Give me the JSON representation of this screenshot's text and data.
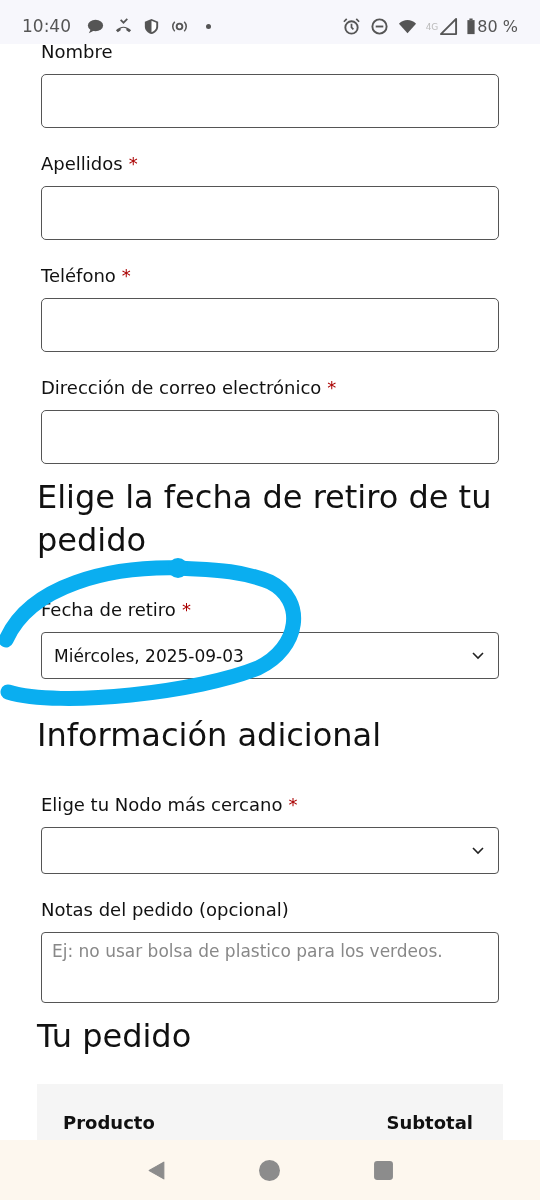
{
  "status_bar": {
    "time": "10:40",
    "network": "4G",
    "battery": "80 %"
  },
  "sections": [
    {
      "fields": [
        {
          "kind": "text",
          "label": "Nombre"
        },
        {
          "kind": "text",
          "label": "Apellidos",
          "required_mark": "*"
        },
        {
          "kind": "text",
          "label": "Teléfono",
          "required_mark": "*"
        },
        {
          "kind": "text",
          "label": "Dirección de correo electrónico",
          "required_mark": "*"
        }
      ]
    },
    {
      "heading": "Elige la fecha de retiro de tu pedido",
      "fields": [
        {
          "kind": "select",
          "label": "Fecha de retiro",
          "required_mark": "*",
          "value": "Miércoles, 2025-09-03"
        }
      ]
    },
    {
      "heading": "Información adicional",
      "fields": [
        {
          "kind": "select",
          "label": "Elige tu Nodo más cercano",
          "required_mark": "*"
        },
        {
          "kind": "textarea",
          "label": "Notas del pedido (opcional)",
          "placeholder": "Ej: no usar bolsa de plastico para los verdeos."
        }
      ]
    },
    {
      "heading": "Tu pedido"
    }
  ],
  "order_table": {
    "columns": [
      "Producto",
      "Subtotal"
    ]
  }
}
